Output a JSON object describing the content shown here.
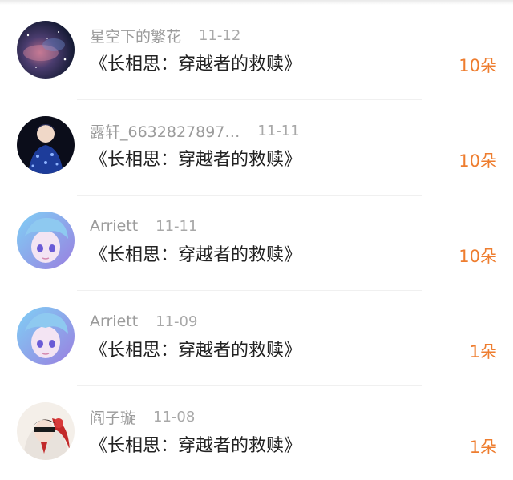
{
  "gift_list": [
    {
      "username": "星空下的繁花",
      "date": "11-12",
      "gift": "《长相思：穿越者的救赎》",
      "amount": "10朵",
      "avatar": "nebula-avatar"
    },
    {
      "username": "露轩_6632827897…",
      "date": "11-11",
      "gift": "《长相思：穿越者的救赎》",
      "amount": "10朵",
      "avatar": "singer-avatar"
    },
    {
      "username": "Arriett",
      "date": "11-11",
      "gift": "《长相思：穿越者的救赎》",
      "amount": "10朵",
      "avatar": "anime-girl-avatar"
    },
    {
      "username": "Arriett",
      "date": "11-09",
      "gift": "《长相思：穿越者的救赎》",
      "amount": "1朵",
      "avatar": "anime-girl-avatar"
    },
    {
      "username": "阎子璇",
      "date": "11-08",
      "gift": "《长相思：穿越者的救赎》",
      "amount": "1朵",
      "avatar": "costume-avatar"
    }
  ],
  "colors": {
    "amount": "#ee7d2f",
    "username": "#9b9b9b",
    "title": "#222222"
  }
}
